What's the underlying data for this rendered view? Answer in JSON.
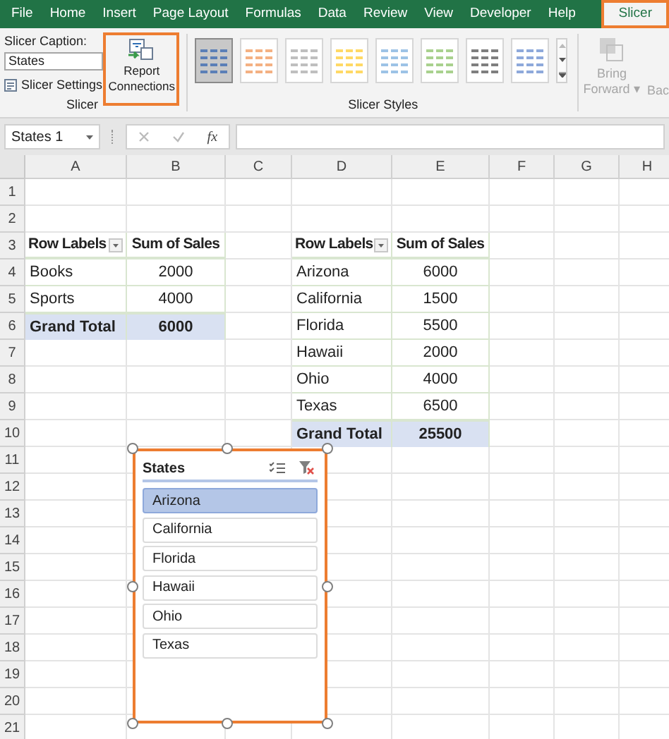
{
  "ribbon_tabs": [
    {
      "label": "File",
      "selected": false
    },
    {
      "label": "Home",
      "selected": false
    },
    {
      "label": "Insert",
      "selected": false
    },
    {
      "label": "Page Layout",
      "selected": false
    },
    {
      "label": "Formulas",
      "selected": false
    },
    {
      "label": "Data",
      "selected": false
    },
    {
      "label": "Review",
      "selected": false
    },
    {
      "label": "View",
      "selected": false
    },
    {
      "label": "Developer",
      "selected": false
    },
    {
      "label": "Help",
      "selected": false
    },
    {
      "label": "Slicer",
      "selected": true
    }
  ],
  "slicer_group": {
    "caption_label": "Slicer Caption:",
    "caption_value": "States",
    "settings_button": "Slicer Settings",
    "report_button": "Report Connections",
    "label": "Slicer"
  },
  "styles_group": {
    "label": "Slicer Styles",
    "styles": [
      {
        "color": "#5b7fb7",
        "selected": true
      },
      {
        "color": "#f4b183",
        "selected": false
      },
      {
        "color": "#bfbfbf",
        "selected": false
      },
      {
        "color": "#ffd966",
        "selected": false
      },
      {
        "color": "#9dc3e6",
        "selected": false
      },
      {
        "color": "#a9d18e",
        "selected": false
      },
      {
        "color": "#7f7f7f",
        "selected": false
      },
      {
        "color": "#8ea9db",
        "selected": false
      }
    ]
  },
  "arrange_group": {
    "bring_forward": "Bring Forward",
    "dropdown_mark": "▾",
    "cut_label": "Bac",
    "disabled": true
  },
  "formula_bar": {
    "name_box": "States 1",
    "function_label": "fx"
  },
  "columns": [
    "A",
    "B",
    "C",
    "D",
    "E",
    "F",
    "G",
    "H"
  ],
  "rows": [
    "1",
    "2",
    "3",
    "4",
    "5",
    "6",
    "7",
    "8",
    "9",
    "10",
    "11",
    "12",
    "13",
    "14",
    "15",
    "16",
    "17",
    "18",
    "19",
    "20",
    "21"
  ],
  "pivot_tables": [
    {
      "header": [
        "Row Labels",
        "Sum of Sales"
      ],
      "rows": [
        [
          "Books",
          "2000"
        ],
        [
          "Sports",
          "4000"
        ]
      ],
      "total": [
        "Grand Total",
        "6000"
      ]
    },
    {
      "header": [
        "Row Labels",
        "Sum of Sales"
      ],
      "rows": [
        [
          "Arizona",
          "6000"
        ],
        [
          "California",
          "1500"
        ],
        [
          "Florida",
          "5500"
        ],
        [
          "Hawaii",
          "2000"
        ],
        [
          "Ohio",
          "4000"
        ],
        [
          "Texas",
          "6500"
        ]
      ],
      "total": [
        "Grand Total",
        "25500"
      ]
    }
  ],
  "slicer": {
    "title": "States",
    "items": [
      {
        "label": "Arizona",
        "selected": true
      },
      {
        "label": "California",
        "selected": false
      },
      {
        "label": "Florida",
        "selected": false
      },
      {
        "label": "Hawaii",
        "selected": false
      },
      {
        "label": "Ohio",
        "selected": false
      },
      {
        "label": "Texas",
        "selected": false
      }
    ]
  }
}
